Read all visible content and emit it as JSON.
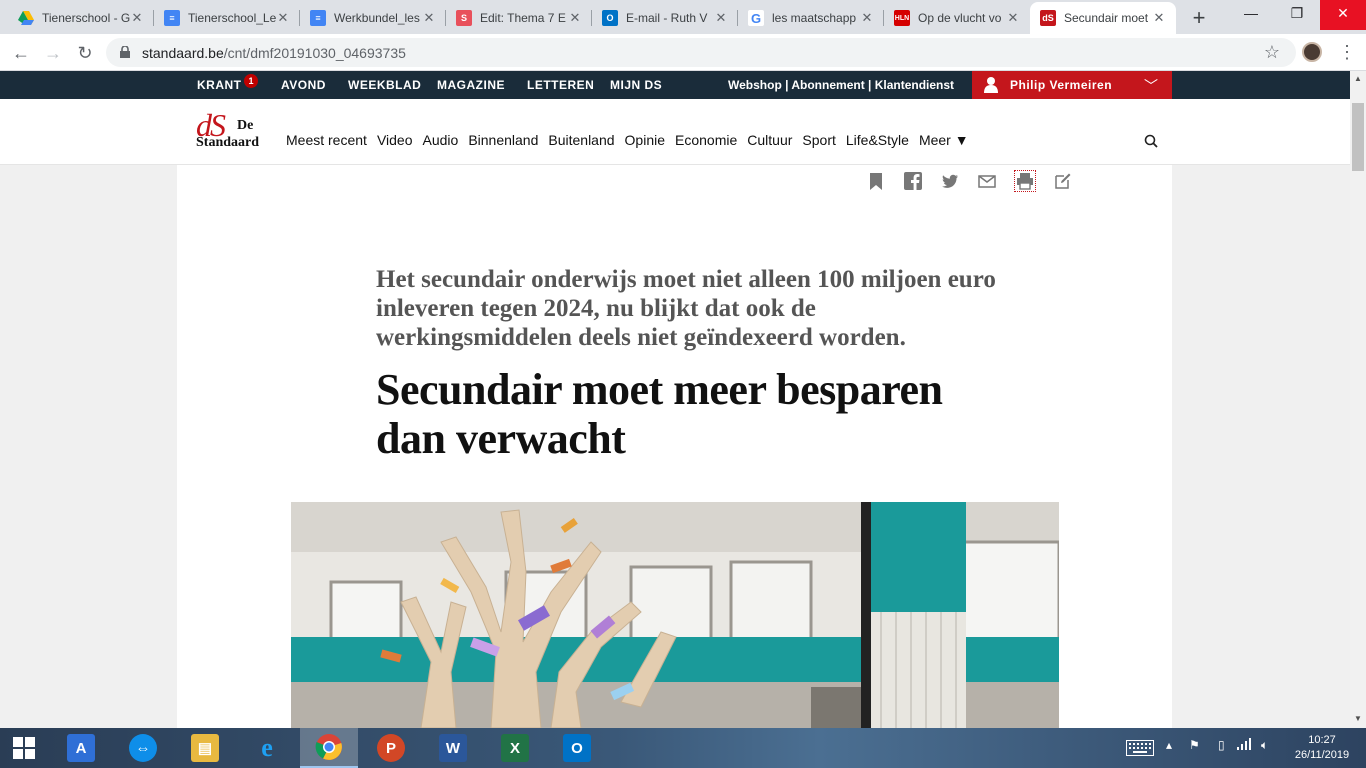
{
  "browser": {
    "tabs": [
      {
        "title": "Tienerschool - G",
        "icon": "google-drive-icon"
      },
      {
        "title": "Tienerschool_Le",
        "icon": "google-docs-icon"
      },
      {
        "title": "Werkbundel_les",
        "icon": "google-docs-icon"
      },
      {
        "title": "Edit: Thema 7 E",
        "icon": "smartschool-icon"
      },
      {
        "title": "E-mail - Ruth V",
        "icon": "outlook-icon"
      },
      {
        "title": "les maatschapp",
        "icon": "google-icon"
      },
      {
        "title": "Op de vlucht vo",
        "icon": "hln-icon"
      },
      {
        "title": "Secundair moet",
        "icon": "ds-icon"
      }
    ],
    "new_tab": "+",
    "url_host": "standaard.be",
    "url_path": "/cnt/dmf20191030_04693735"
  },
  "topbar": {
    "krant": "KRANT",
    "krant_badge": "1",
    "avond": "AVOND",
    "weekblad": "WEEKBLAD",
    "magazine": "MAGAZINE",
    "letteren": "LETTEREN",
    "mijn_ds": "MIJN DS",
    "links": "Webshop | Abonnement | Klantendienst",
    "user_name": "Philip Vermeiren"
  },
  "header": {
    "logo_ds": "dS",
    "logo_de": "De",
    "logo_standaard": "Standaard",
    "nav": [
      "Meest recent",
      "Video",
      "Audio",
      "Binnenland",
      "Buitenland",
      "Opinie",
      "Economie",
      "Cultuur",
      "Sport",
      "Life&Style",
      "Meer ▼"
    ]
  },
  "article": {
    "lead": "Het secundair onderwijs moet niet alleen 100 miljoen euro inleveren tegen 2024, nu blijkt dat ook de werkingsmiddelen deels niet geïndexeerd worden.",
    "headline": "Secundair moet meer besparen dan verwacht"
  },
  "taskbar": {
    "clock_time": "10:27",
    "clock_date": "26/11/2019"
  },
  "colors": {
    "brand_red": "#c4161c",
    "topbar_navy": "#1a2c3a"
  }
}
